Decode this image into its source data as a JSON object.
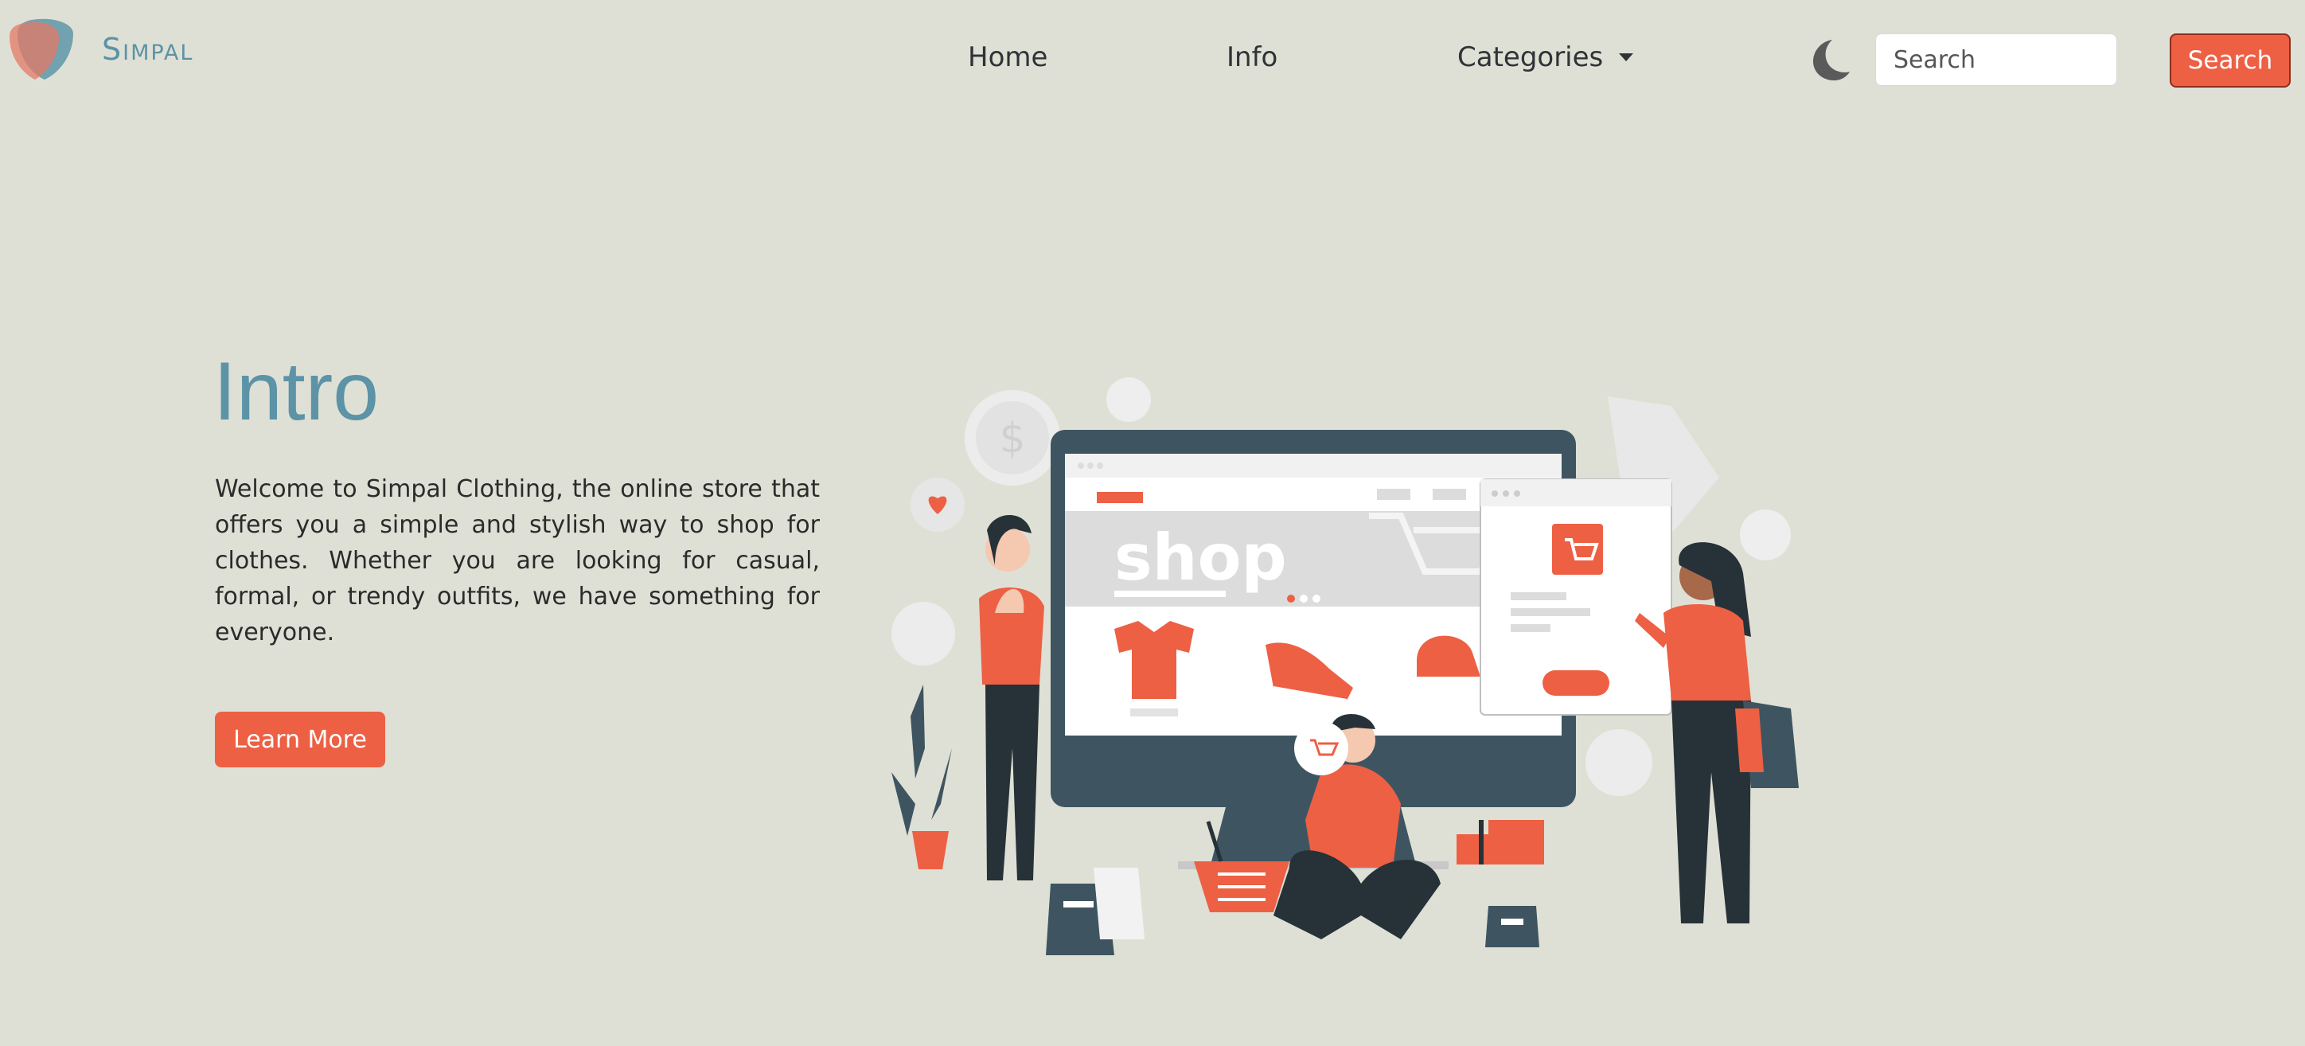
{
  "brand": {
    "name": "Simpal",
    "logo_icon": "shield-logo-icon"
  },
  "nav": {
    "items": [
      {
        "label": "Home"
      },
      {
        "label": "Info"
      },
      {
        "label": "Categories"
      }
    ],
    "theme_toggle_icon": "moon-icon",
    "search": {
      "placeholder": "Search",
      "value": "",
      "button_label": "Search"
    }
  },
  "hero": {
    "title": "Intro",
    "description": "Welcome to Simpal Clothing, the online store that offers you a simple and stylish way to shop for clothes. Whether you are looking for casual, formal, or trendy outfits, we have something for everyone.",
    "button_label": "Learn More",
    "illustration": {
      "screen_text": "shop",
      "icon": "online-shopping-illustration"
    }
  },
  "colors": {
    "background": "#dfe0d5",
    "accent": "#ed6044",
    "brand": "#5c93a7",
    "dark": "#3e5561"
  }
}
